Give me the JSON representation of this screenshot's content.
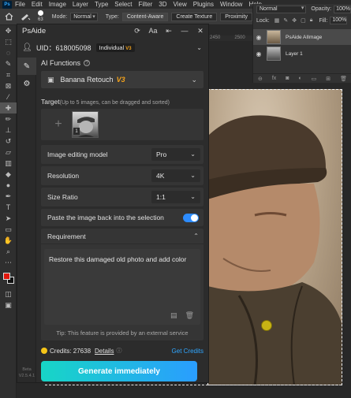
{
  "photoshop": {
    "logo": "Ps",
    "menu": [
      "File",
      "Edit",
      "Image",
      "Layer",
      "Type",
      "Select",
      "Filter",
      "3D",
      "View",
      "Plugins",
      "Window",
      "Help"
    ],
    "options": {
      "brush_size": "63",
      "mode_label": "Mode:",
      "mode_value": "Normal",
      "type_label": "Type:",
      "type_options": [
        "Content-Aware",
        "Create Texture",
        "Proximity"
      ]
    },
    "ruler_ticks": [
      "2450",
      "2500",
      "2550"
    ],
    "layers": {
      "blend_mode": "Normal",
      "opacity_label": "Opacity:",
      "opacity_value": "100%",
      "lock_label": "Lock:",
      "fill_label": "Fill:",
      "fill_value": "100%",
      "items": [
        {
          "name": "PsAide AIImage",
          "selected": true
        },
        {
          "name": "Layer 1",
          "selected": false
        }
      ]
    }
  },
  "plugin": {
    "title": "PsAide",
    "uid": "UID：618005098",
    "plan": "Individual",
    "plan_tag": "V3",
    "title_icons": [
      "refresh-icon",
      "text-size-icon",
      "pin-icon",
      "minimize-icon",
      "close-icon"
    ],
    "version": [
      "Beta",
      "V2.5.4.1"
    ],
    "ai_functions_label": "AI Functions",
    "function_name": "Banana Retouch",
    "function_tag": "V3",
    "target_label": "Target",
    "target_hint": "(Up to 5 images, can be dragged and sorted)",
    "target_badge": "1",
    "options": [
      {
        "label": "Image editing model",
        "value": "Pro"
      },
      {
        "label": "Resolution",
        "value": "4K"
      },
      {
        "label": "Size Ratio",
        "value": "1:1"
      }
    ],
    "paste_label": "Paste the image back into the selection",
    "paste_enabled": true,
    "requirement_label": "Requirement",
    "requirement_text": "Restore this damaged old photo and add color",
    "tip": "Tip: This feature is provided by an external service",
    "credits_label": "Credits: 27638",
    "details_label": "Details",
    "get_credits_label": "Get Credits",
    "generate_label": "Generate immediately",
    "colors": {
      "accent": "#2a9dff",
      "gradient_start": "#17d6c6",
      "v3": "#f3a21b",
      "coin": "#f5c518"
    }
  }
}
